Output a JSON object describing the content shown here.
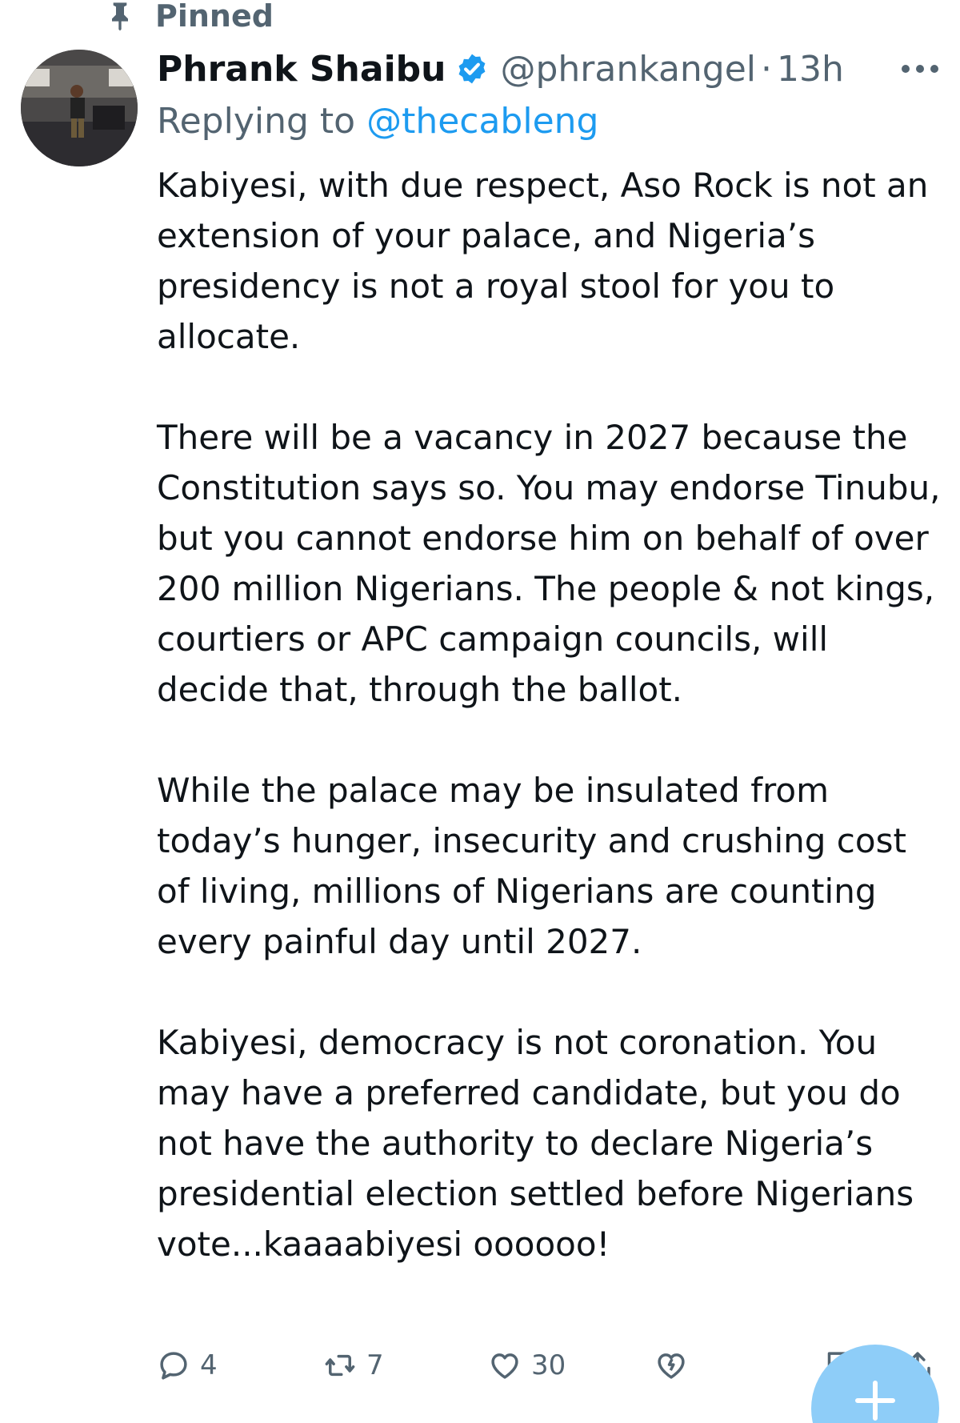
{
  "pinned": {
    "label": "Pinned",
    "icon": "pin-icon"
  },
  "author": {
    "display_name": "Phrank Shaibu",
    "handle": "@phrankangel",
    "separator": "·",
    "time": "13h",
    "verified_color": "#1d9bf0"
  },
  "reply": {
    "prefix": "Replying to",
    "handle": "@thecableng"
  },
  "tweet": {
    "paragraphs": [
      "Kabiyesi, with due respect, Aso Rock is not an extension of your palace, and Nigeria’s presidency is not a royal stool for you to allocate.",
      "There will be a vacancy in 2027 because the Constitution says so. You may endorse Tinubu, but you cannot endorse him on behalf of over 200 million Nigerians. The people & not kings, courtiers or APC campaign councils, will decide that, through the ballot.",
      "While the palace may be insulated from today’s hunger, insecurity and crushing cost of living, millions of Nigerians are counting every painful day until 2027.",
      "Kabiyesi, democracy is not coronation. You may have a preferred candidate, but you do not have the authority to declare Nigeria’s presidential election settled before Nigerians vote...kaaaabiyesi oooooo!"
    ]
  },
  "actions": {
    "replies": "4",
    "reposts": "7",
    "likes": "30"
  },
  "colors": {
    "text": "#0f1419",
    "secondary": "#536471",
    "link": "#1d9bf0",
    "fab": "#8ecdf8"
  }
}
